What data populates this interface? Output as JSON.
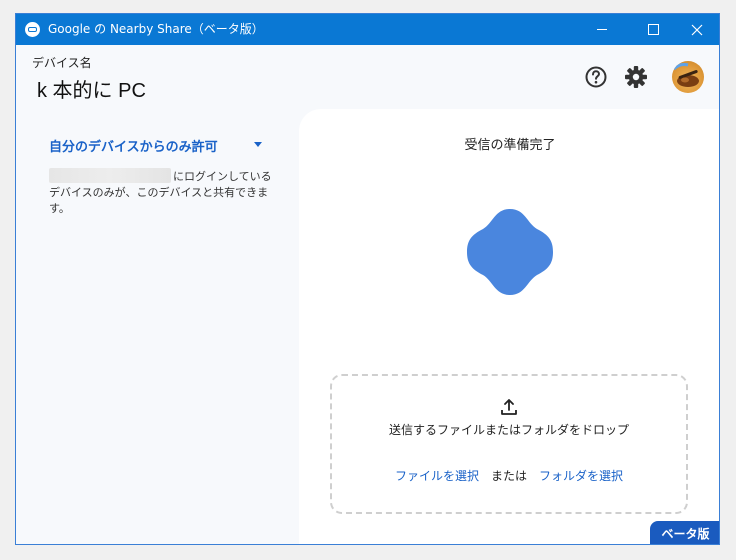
{
  "window": {
    "title": "Google の Nearby Share（ベータ版）"
  },
  "header": {
    "device_label": "デバイス名",
    "device_name": "k 本的に PC"
  },
  "left": {
    "visibility_selected": "自分のデバイスからのみ許可",
    "description_after_account": "にログインしているデバイスのみが、このデバイスと共有できます。"
  },
  "right": {
    "status": "受信の準備完了",
    "drop_prompt": "送信するファイルまたはフォルダをドロップ",
    "choose_file": "ファイルを選択",
    "or": "または",
    "choose_folder": "フォルダを選択"
  },
  "badge": {
    "beta": "ベータ版"
  },
  "icons": {
    "app": "nearby-share-icon",
    "help": "help-icon",
    "settings": "gear-icon",
    "upload": "upload-icon",
    "dropdown": "dropdown-arrow-icon"
  },
  "colors": {
    "titlebar": "#0a78d4",
    "accent": "#1a62c8",
    "blob": "#4a86de"
  }
}
